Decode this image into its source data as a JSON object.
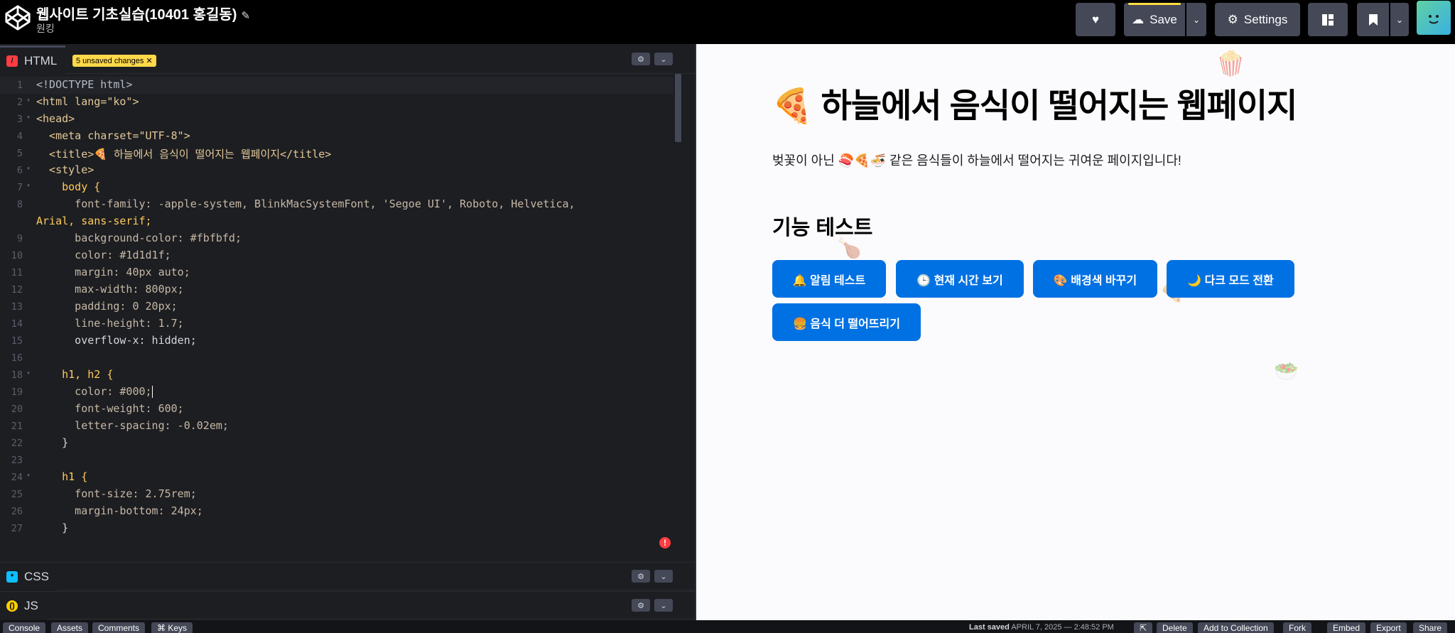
{
  "header": {
    "title": "웹사이트 기초실습(10401 홍길동)",
    "owner": "원킹",
    "buttons": {
      "save": "Save",
      "settings": "Settings"
    }
  },
  "editor": {
    "html_label": "HTML",
    "unsaved_badge": "5 unsaved changes",
    "css_label": "CSS",
    "js_label": "JS",
    "lines": [
      {
        "n": "1",
        "text": "<!DOCTYPE html>"
      },
      {
        "n": "2",
        "text": "<html lang=\"ko\">"
      },
      {
        "n": "3",
        "text": "<head>"
      },
      {
        "n": "4",
        "text": "  <meta charset=\"UTF-8\">"
      },
      {
        "n": "5",
        "text": "  <title>🍕 하늘에서 음식이 떨어지는 웹페이지</title>"
      },
      {
        "n": "6",
        "text": "  <style>"
      },
      {
        "n": "7",
        "text": "    body {"
      },
      {
        "n": "8",
        "text": "      font-family: -apple-system, BlinkMacSystemFont, 'Segoe UI', Roboto, Helvetica,"
      },
      {
        "n": "",
        "text": "Arial, sans-serif;"
      },
      {
        "n": "9",
        "text": "      background-color: #fbfbfd;"
      },
      {
        "n": "10",
        "text": "      color: #1d1d1f;"
      },
      {
        "n": "11",
        "text": "      margin: 40px auto;"
      },
      {
        "n": "12",
        "text": "      max-width: 800px;"
      },
      {
        "n": "13",
        "text": "      padding: 0 20px;"
      },
      {
        "n": "14",
        "text": "      line-height: 1.7;"
      },
      {
        "n": "15",
        "text": "      overflow-x: hidden;"
      },
      {
        "n": "16",
        "text": "    }"
      },
      {
        "n": "17",
        "text": ""
      },
      {
        "n": "18",
        "text": "    h1, h2 {"
      },
      {
        "n": "19",
        "text": "      color: #000;"
      },
      {
        "n": "20",
        "text": "      font-weight: 600;"
      },
      {
        "n": "21",
        "text": "      letter-spacing: -0.02em;"
      },
      {
        "n": "22",
        "text": "    }"
      },
      {
        "n": "23",
        "text": ""
      },
      {
        "n": "24",
        "text": "    h1 {"
      },
      {
        "n": "25",
        "text": "      font-size: 2.75rem;"
      },
      {
        "n": "26",
        "text": "      margin-bottom: 24px;"
      },
      {
        "n": "27",
        "text": "    }"
      }
    ]
  },
  "preview": {
    "h1": "🍕 하늘에서 음식이 떨어지는 웹페이지",
    "paragraph": "벚꽃이 아닌 🍣🍕🍜 같은 음식들이 하늘에서 떨어지는 귀여운 페이지입니다!",
    "h2": "기능 테스트",
    "buttons": [
      "🔔 알림 테스트",
      "🕒 현재 시간 보기",
      "🎨 배경색 바꾸기",
      "🌙 다크 모드 전환",
      "🍔 음식 더 떨어뜨리기"
    ],
    "falling_food": [
      "🍿",
      "🍗",
      "🍕",
      "🥗"
    ]
  },
  "footer": {
    "tabs": [
      "Console",
      "Assets",
      "Comments",
      "⌘ Keys"
    ],
    "last_saved_label": "Last saved",
    "last_saved_value": "APRIL 7, 2025 — 2:48:52 PM",
    "actions": [
      "Delete",
      "Add to Collection",
      "Fork",
      "Embed",
      "Export",
      "Share"
    ]
  },
  "colors": {
    "accent": "#ffdd40",
    "button_blue": "#0071e3",
    "html_icon": "#ff3c41",
    "css_icon": "#0ebeff",
    "js_icon": "#fcd000"
  }
}
